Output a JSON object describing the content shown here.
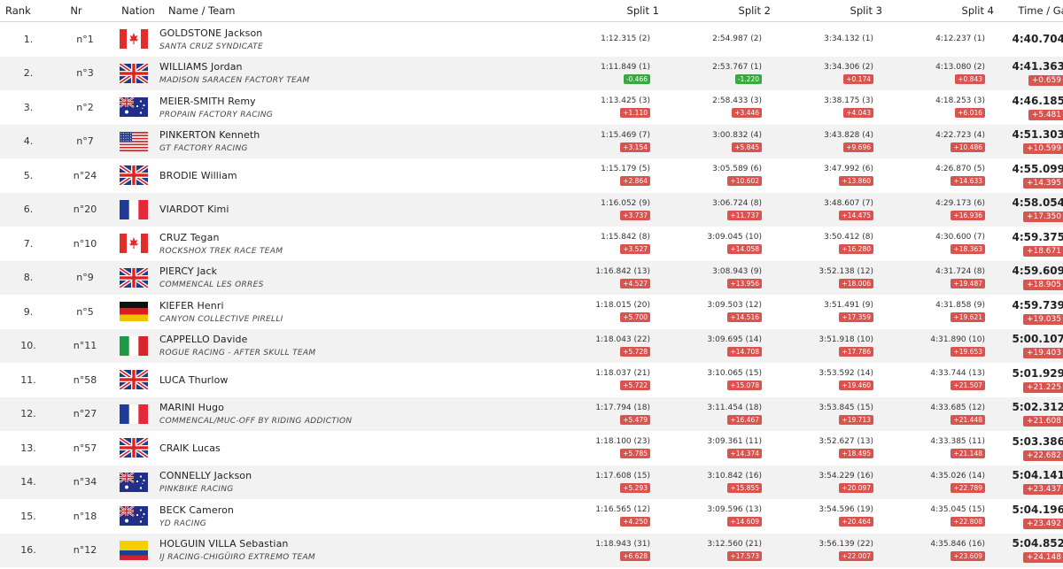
{
  "headers": {
    "rank": "Rank",
    "nr": "Nr",
    "nation": "Nation",
    "name": "Name / Team",
    "split1": "Split 1",
    "split2": "Split 2",
    "split3": "Split 3",
    "split4": "Split 4",
    "time": "Time / Gap"
  },
  "rows": [
    {
      "rank": "1.",
      "nr": "n°1",
      "flag": "canada-flag",
      "name": "GOLDSTONE Jackson",
      "team": "SANTA CRUZ SYNDICATE",
      "s": [
        {
          "t": "1:12.315 (2)",
          "g": ""
        },
        {
          "t": "2:54.987 (2)",
          "g": ""
        },
        {
          "t": "3:34.132 (1)",
          "g": ""
        },
        {
          "t": "4:12.237 (1)",
          "g": ""
        }
      ],
      "time": "4:40.704",
      "gap": ""
    },
    {
      "rank": "2.",
      "nr": "n°3",
      "flag": "uk-flag",
      "name": "WILLIAMS Jordan",
      "team": "MADISON SARACEN FACTORY TEAM",
      "s": [
        {
          "t": "1:11.849 (1)",
          "g": "-0.466"
        },
        {
          "t": "2:53.767 (1)",
          "g": "-1.220"
        },
        {
          "t": "3:34.306 (2)",
          "g": "+0.174"
        },
        {
          "t": "4:13.080 (2)",
          "g": "+0.843"
        }
      ],
      "time": "4:41.363",
      "gap": "+0.659"
    },
    {
      "rank": "3.",
      "nr": "n°2",
      "flag": "australia-flag",
      "name": "MEIER-SMITH Remy",
      "team": "PROPAIN FACTORY RACING",
      "s": [
        {
          "t": "1:13.425 (3)",
          "g": "+1.110"
        },
        {
          "t": "2:58.433 (3)",
          "g": "+3.446"
        },
        {
          "t": "3:38.175 (3)",
          "g": "+4.043"
        },
        {
          "t": "4:18.253 (3)",
          "g": "+6.016"
        }
      ],
      "time": "4:46.185",
      "gap": "+5.481"
    },
    {
      "rank": "4.",
      "nr": "n°7",
      "flag": "usa-flag",
      "name": "PINKERTON Kenneth",
      "team": "GT FACTORY RACING",
      "s": [
        {
          "t": "1:15.469 (7)",
          "g": "+3.154"
        },
        {
          "t": "3:00.832 (4)",
          "g": "+5.845"
        },
        {
          "t": "3:43.828 (4)",
          "g": "+9.696"
        },
        {
          "t": "4:22.723 (4)",
          "g": "+10.486"
        }
      ],
      "time": "4:51.303",
      "gap": "+10.599"
    },
    {
      "rank": "5.",
      "nr": "n°24",
      "flag": "uk-flag",
      "name": "BRODIE William",
      "team": "",
      "s": [
        {
          "t": "1:15.179 (5)",
          "g": "+2.864"
        },
        {
          "t": "3:05.589 (6)",
          "g": "+10.602"
        },
        {
          "t": "3:47.992 (6)",
          "g": "+13.860"
        },
        {
          "t": "4:26.870 (5)",
          "g": "+14.633"
        }
      ],
      "time": "4:55.099",
      "gap": "+14.395"
    },
    {
      "rank": "6.",
      "nr": "n°20",
      "flag": "france-flag",
      "name": "VIARDOT Kimi",
      "team": "",
      "s": [
        {
          "t": "1:16.052 (9)",
          "g": "+3.737"
        },
        {
          "t": "3:06.724 (8)",
          "g": "+11.737"
        },
        {
          "t": "3:48.607 (7)",
          "g": "+14.475"
        },
        {
          "t": "4:29.173 (6)",
          "g": "+16.936"
        }
      ],
      "time": "4:58.054",
      "gap": "+17.350"
    },
    {
      "rank": "7.",
      "nr": "n°10",
      "flag": "canada-flag",
      "name": "CRUZ Tegan",
      "team": "ROCKSHOX TREK RACE TEAM",
      "s": [
        {
          "t": "1:15.842 (8)",
          "g": "+3.527"
        },
        {
          "t": "3:09.045 (10)",
          "g": "+14.058"
        },
        {
          "t": "3:50.412 (8)",
          "g": "+16.280"
        },
        {
          "t": "4:30.600 (7)",
          "g": "+18.363"
        }
      ],
      "time": "4:59.375",
      "gap": "+18.671"
    },
    {
      "rank": "8.",
      "nr": "n°9",
      "flag": "uk-flag",
      "name": "PIERCY Jack",
      "team": "COMMENCAL LES ORRES",
      "s": [
        {
          "t": "1:16.842 (13)",
          "g": "+4.527"
        },
        {
          "t": "3:08.943 (9)",
          "g": "+13.956"
        },
        {
          "t": "3:52.138 (12)",
          "g": "+18.006"
        },
        {
          "t": "4:31.724 (8)",
          "g": "+19.487"
        }
      ],
      "time": "4:59.609",
      "gap": "+18.905"
    },
    {
      "rank": "9.",
      "nr": "n°5",
      "flag": "germany-flag",
      "name": "KIEFER Henri",
      "team": "CANYON COLLECTIVE PIRELLI",
      "s": [
        {
          "t": "1:18.015 (20)",
          "g": "+5.700"
        },
        {
          "t": "3:09.503 (12)",
          "g": "+14.516"
        },
        {
          "t": "3:51.491 (9)",
          "g": "+17.359"
        },
        {
          "t": "4:31.858 (9)",
          "g": "+19.621"
        }
      ],
      "time": "4:59.739",
      "gap": "+19.035"
    },
    {
      "rank": "10.",
      "nr": "n°11",
      "flag": "italy-flag",
      "name": "CAPPELLO Davide",
      "team": "ROGUE RACING - AFTER SKULL TEAM",
      "s": [
        {
          "t": "1:18.043 (22)",
          "g": "+5.728"
        },
        {
          "t": "3:09.695 (14)",
          "g": "+14.708"
        },
        {
          "t": "3:51.918 (10)",
          "g": "+17.786"
        },
        {
          "t": "4:31.890 (10)",
          "g": "+19.653"
        }
      ],
      "time": "5:00.107",
      "gap": "+19.403"
    },
    {
      "rank": "11.",
      "nr": "n°58",
      "flag": "uk-flag",
      "name": "LUCA Thurlow",
      "team": "",
      "s": [
        {
          "t": "1:18.037 (21)",
          "g": "+5.722"
        },
        {
          "t": "3:10.065 (15)",
          "g": "+15.078"
        },
        {
          "t": "3:53.592 (14)",
          "g": "+19.460"
        },
        {
          "t": "4:33.744 (13)",
          "g": "+21.507"
        }
      ],
      "time": "5:01.929",
      "gap": "+21.225"
    },
    {
      "rank": "12.",
      "nr": "n°27",
      "flag": "france-flag",
      "name": "MARINI Hugo",
      "team": "COMMENCAL/MUC-OFF BY RIDING ADDICTION",
      "s": [
        {
          "t": "1:17.794 (18)",
          "g": "+5.479"
        },
        {
          "t": "3:11.454 (18)",
          "g": "+16.467"
        },
        {
          "t": "3:53.845 (15)",
          "g": "+19.713"
        },
        {
          "t": "4:33.685 (12)",
          "g": "+21.448"
        }
      ],
      "time": "5:02.312",
      "gap": "+21.608"
    },
    {
      "rank": "13.",
      "nr": "n°57",
      "flag": "uk-flag",
      "name": "CRAIK Lucas",
      "team": "",
      "s": [
        {
          "t": "1:18.100 (23)",
          "g": "+5.785"
        },
        {
          "t": "3:09.361 (11)",
          "g": "+14.374"
        },
        {
          "t": "3:52.627 (13)",
          "g": "+18.495"
        },
        {
          "t": "4:33.385 (11)",
          "g": "+21.148"
        }
      ],
      "time": "5:03.386",
      "gap": "+22.682"
    },
    {
      "rank": "14.",
      "nr": "n°34",
      "flag": "australia-flag",
      "name": "CONNELLY Jackson",
      "team": "PINKBIKE RACING",
      "s": [
        {
          "t": "1:17.608 (15)",
          "g": "+5.293"
        },
        {
          "t": "3:10.842 (16)",
          "g": "+15.855"
        },
        {
          "t": "3:54.229 (16)",
          "g": "+20.097"
        },
        {
          "t": "4:35.026 (14)",
          "g": "+22.789"
        }
      ],
      "time": "5:04.141",
      "gap": "+23.437"
    },
    {
      "rank": "15.",
      "nr": "n°18",
      "flag": "australia-flag",
      "name": "BECK Cameron",
      "team": "YD RACING",
      "s": [
        {
          "t": "1:16.565 (12)",
          "g": "+4.250"
        },
        {
          "t": "3:09.596 (13)",
          "g": "+14.609"
        },
        {
          "t": "3:54.596 (19)",
          "g": "+20.464"
        },
        {
          "t": "4:35.045 (15)",
          "g": "+22.808"
        }
      ],
      "time": "5:04.196",
      "gap": "+23.492"
    },
    {
      "rank": "16.",
      "nr": "n°12",
      "flag": "colombia-flag",
      "name": "HOLGUIN VILLA Sebastian",
      "team": "IJ RACING-CHIGÜIRO EXTREMO TEAM",
      "s": [
        {
          "t": "1:18.943 (31)",
          "g": "+6.628"
        },
        {
          "t": "3:12.560 (21)",
          "g": "+17.573"
        },
        {
          "t": "3:56.139 (22)",
          "g": "+22.007"
        },
        {
          "t": "4:35.846 (16)",
          "g": "+23.609"
        }
      ],
      "time": "5:04.852",
      "gap": "+24.148"
    }
  ],
  "colors": {
    "gap_positive": "#d9534f",
    "gap_negative": "#3aa840",
    "row_alt": "#f2f2f2"
  }
}
